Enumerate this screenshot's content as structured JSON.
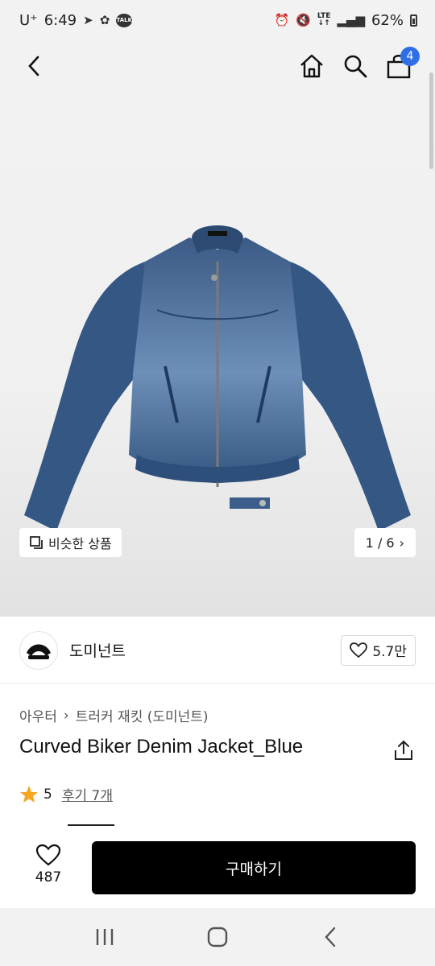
{
  "status_bar": {
    "carrier": "U⁺",
    "time": "6:49",
    "talk_badge": "TALK",
    "network": "LTE",
    "battery": "62%"
  },
  "nav": {
    "cart_count": "4"
  },
  "gallery": {
    "similar_label": "비슷한 상품",
    "page_indicator": "1 / 6"
  },
  "brand": {
    "name": "도미넌트",
    "likes": "5.7만"
  },
  "breadcrumb": [
    "아우터",
    "트러커 재킷 (도미넌트)"
  ],
  "product": {
    "title": "Curved Biker Denim Jacket_Blue",
    "rating": "5",
    "reviews": "후기 7개"
  },
  "action_bar": {
    "wish_count": "487",
    "buy_label": "구매하기"
  },
  "colors": {
    "accent_badge": "#2f6fe6",
    "buy_button": "#000000",
    "star": "#f5a623",
    "denim": "#3a5f8c"
  }
}
